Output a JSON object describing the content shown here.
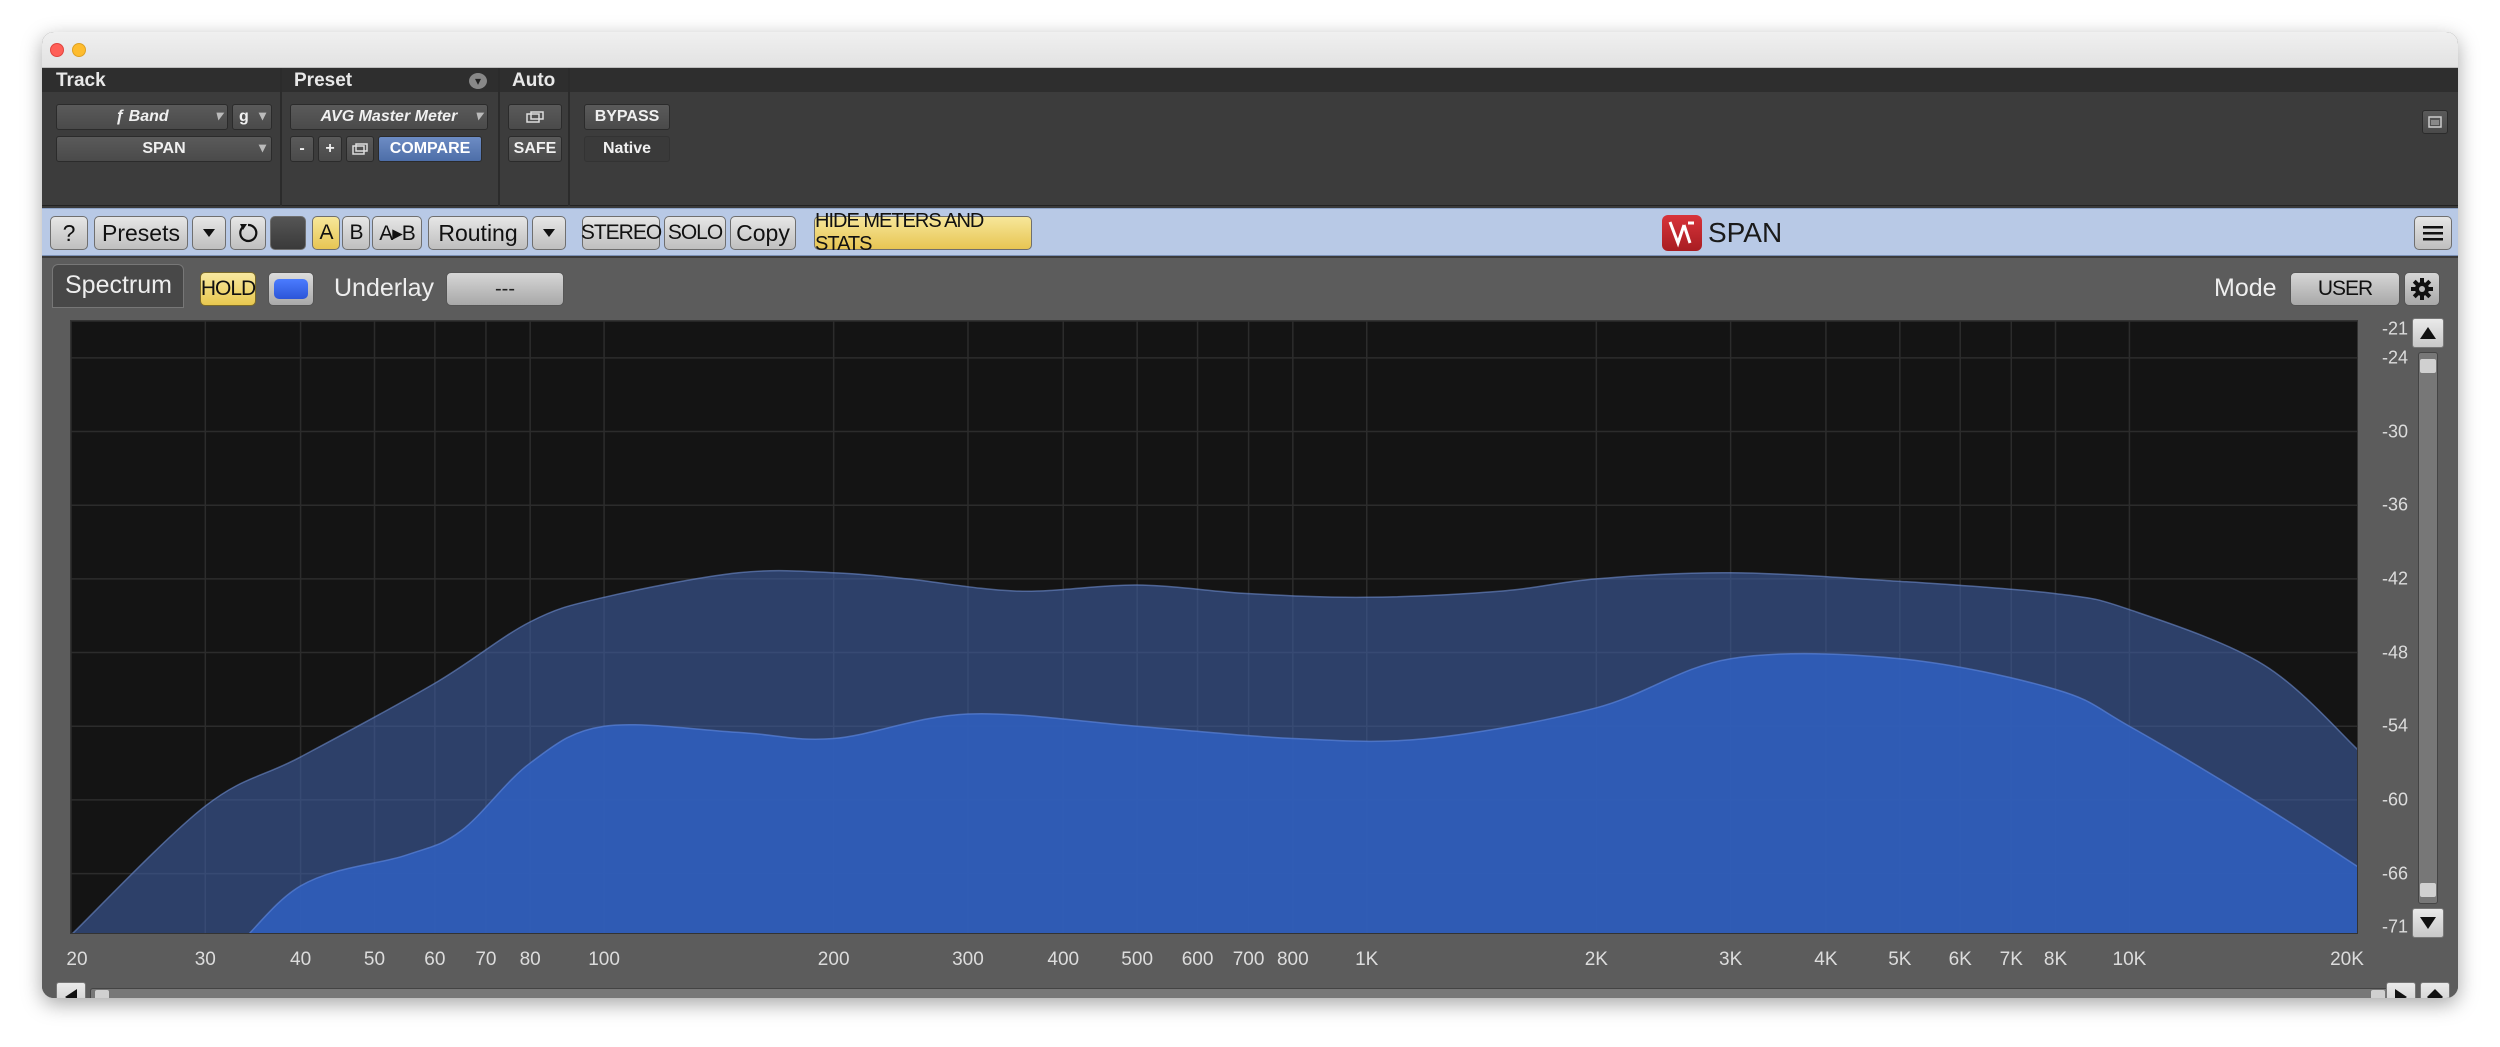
{
  "header": {
    "track_label": "Track",
    "preset_label": "Preset",
    "auto_label": "Auto",
    "track_name": "ƒ Band",
    "track_group": "g",
    "plugin_slot": "SPAN",
    "preset_name": "AVG Master Meter",
    "minus": "-",
    "plus": "+",
    "compare": "COMPARE",
    "bypass": "BYPASS",
    "safe": "SAFE",
    "native": "Native"
  },
  "toolbar": {
    "help": "?",
    "presets": "Presets",
    "a": "A",
    "b": "B",
    "ab": "A▸B",
    "routing": "Routing",
    "stereo": "STEREO",
    "solo": "SOLO",
    "copy": "Copy",
    "hide_meters": "HIDE METERS AND STATS",
    "logo_text": "SPAN"
  },
  "panel": {
    "spectrum_tab": "Spectrum",
    "hold": "HOLD",
    "underlay_label": "Underlay",
    "underlay_value": "---",
    "mode_label": "Mode",
    "mode_value": "USER"
  },
  "colors": {
    "accent_yellow": "#f2dc7e",
    "spectrum_fill": "#2f5db8",
    "toolbar_bg": "#b8c9e6"
  },
  "chart_data": {
    "type": "area",
    "x_scale": "log",
    "x_range": [
      20,
      20000
    ],
    "y_range": [
      -71,
      -21
    ],
    "x_tick_labels": [
      "20",
      "30",
      "40",
      "50",
      "60",
      "70",
      "80",
      "100",
      "200",
      "300",
      "400",
      "500",
      "600",
      "700",
      "800",
      "1K",
      "2K",
      "3K",
      "4K",
      "5K",
      "6K",
      "7K",
      "8K",
      "10K",
      "20K"
    ],
    "x_tick_values": [
      20,
      30,
      40,
      50,
      60,
      70,
      80,
      100,
      200,
      300,
      400,
      500,
      600,
      700,
      800,
      1000,
      2000,
      3000,
      4000,
      5000,
      6000,
      7000,
      8000,
      10000,
      20000
    ],
    "y_tick_labels": [
      "-21",
      "-24",
      "-30",
      "-36",
      "-42",
      "-48",
      "-54",
      "-60",
      "-66",
      "-71"
    ],
    "y_tick_values": [
      -21,
      -24,
      -30,
      -36,
      -42,
      -48,
      -54,
      -60,
      -66,
      -71
    ],
    "series": [
      {
        "points": [
          [
            20,
            -71
          ],
          [
            30,
            -60.5
          ],
          [
            40,
            -56.5
          ],
          [
            60,
            -50.5
          ],
          [
            80,
            -45.5
          ],
          [
            100,
            -43.5
          ],
          [
            150,
            -41.5
          ],
          [
            200,
            -41.5
          ],
          [
            250,
            -42
          ],
          [
            350,
            -43
          ],
          [
            500,
            -42.5
          ],
          [
            700,
            -43.2
          ],
          [
            1000,
            -43.5
          ],
          [
            1500,
            -43
          ],
          [
            2000,
            -42
          ],
          [
            3000,
            -41.5
          ],
          [
            5000,
            -42.2
          ],
          [
            8000,
            -43.2
          ],
          [
            10000,
            -44.5
          ],
          [
            15000,
            -49
          ],
          [
            20000,
            -56
          ]
        ]
      },
      {
        "points": [
          [
            20,
            -78
          ],
          [
            30,
            -74
          ],
          [
            40,
            -67
          ],
          [
            55,
            -64.5
          ],
          [
            65,
            -62.5
          ],
          [
            80,
            -57
          ],
          [
            100,
            -54
          ],
          [
            150,
            -54.5
          ],
          [
            200,
            -55
          ],
          [
            300,
            -53
          ],
          [
            500,
            -54
          ],
          [
            800,
            -55
          ],
          [
            1200,
            -55
          ],
          [
            2000,
            -52.5
          ],
          [
            3000,
            -48.5
          ],
          [
            5000,
            -48.5
          ],
          [
            8000,
            -51
          ],
          [
            10000,
            -54
          ],
          [
            15000,
            -60.5
          ],
          [
            20000,
            -65.5
          ]
        ]
      }
    ]
  }
}
